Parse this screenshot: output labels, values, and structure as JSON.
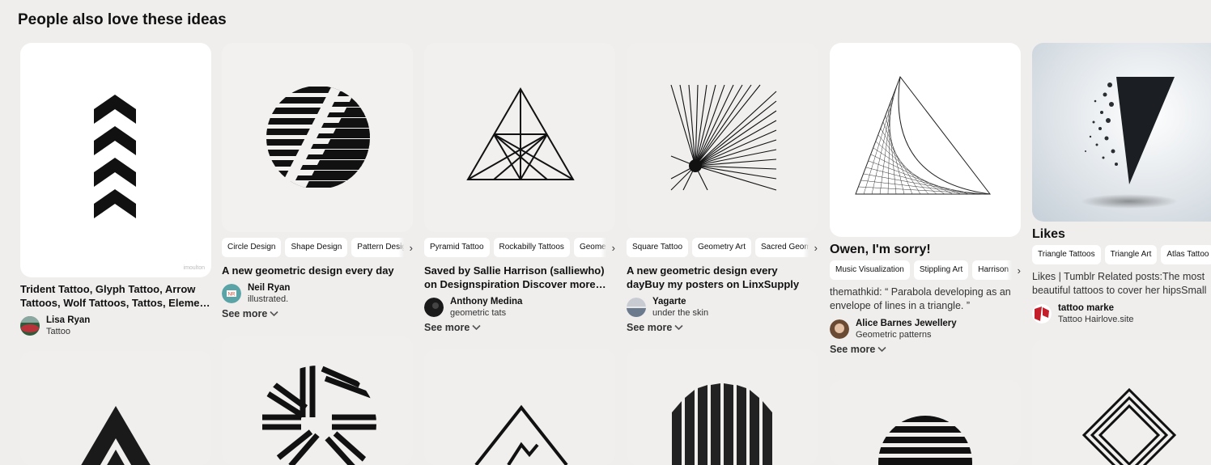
{
  "section_title": "People also love these ideas",
  "pins": [
    {
      "tags": [],
      "title": "Trident Tattoo, Glyph Tattoo, Arrow Tattoos, Wolf Tattoos, Tattos, Eleme…",
      "description": "",
      "pinner_name": "Lisa Ryan",
      "pinner_board": "Tattoo",
      "see_more": "",
      "watermark": "imoulton"
    },
    {
      "tags": [
        "Circle Design",
        "Shape Design",
        "Pattern Design"
      ],
      "title": "A new geometric design every day",
      "description": "",
      "pinner_name": "Neil Ryan",
      "pinner_board": "illustrated.",
      "see_more": "See more",
      "avatar_text": "NR"
    },
    {
      "tags": [
        "Pyramid Tattoo",
        "Rockabilly Tattoos",
        "Geometric"
      ],
      "title": "Saved by Sallie Harrison (salliewho) on Designspiration Discover more…",
      "description": "",
      "pinner_name": "Anthony Medina",
      "pinner_board": "geometric tats",
      "see_more": "See more"
    },
    {
      "tags": [
        "Square Tattoo",
        "Geometry Art",
        "Sacred Geometry"
      ],
      "title": "A new geometric design every dayBuy my posters on LinxSupply",
      "description": "",
      "pinner_name": "Yagarte",
      "pinner_board": "under the skin",
      "see_more": "See more"
    },
    {
      "tags": [
        "Music Visualization",
        "Stippling Art",
        "Harrison"
      ],
      "title": "Owen, I'm sorry!",
      "description": "themathkid: “ Parabola developing as an envelope of lines in a triangle. ”",
      "pinner_name": "Alice Barnes Jewellery",
      "pinner_board": "Geometric patterns",
      "see_more": "See more"
    },
    {
      "tags": [
        "Triangle Tattoos",
        "Triangle Art",
        "Atlas Tattoo"
      ],
      "title": "Likes",
      "description": "Likes | Tumblr Related posts:The most beautiful tattoos to cover her hipsSmall",
      "pinner_name": "tattoo marke",
      "pinner_board": "Tattoo Hairlove.site",
      "see_more": ""
    }
  ],
  "icons": {
    "tag_scroll": "chevron-right-icon",
    "see_more": "chevron-down-icon"
  },
  "colors": {
    "background": "#efeeed",
    "card": "#ffffff",
    "ink": "#111111"
  }
}
